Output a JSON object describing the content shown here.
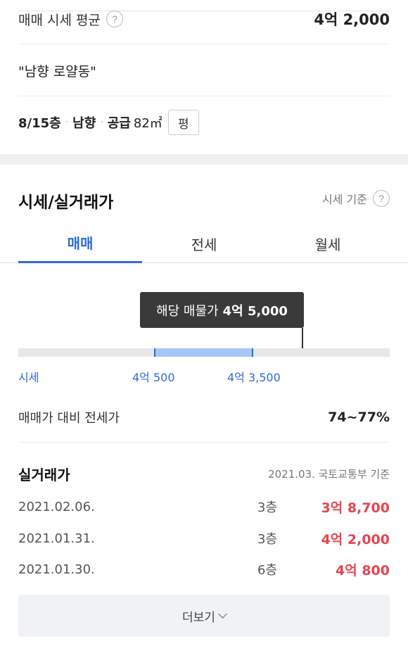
{
  "summary": {
    "avg_label": "매매 시세 평균",
    "help_icon": "question-circle-icon",
    "help_glyph": "?",
    "avg_value": "4억 2,000",
    "quote": "\"남향 로얄동\"",
    "floor": "8/15층",
    "direction": "남향",
    "supply_label": "공급",
    "supply_area": "82㎡",
    "sep": "·",
    "pyeong_button": "평"
  },
  "section": {
    "title": "시세/실거래가",
    "basis": "시세 기준",
    "basis_glyph": "?"
  },
  "tabs": [
    {
      "label": "매매",
      "active": true
    },
    {
      "label": "전세",
      "active": false
    },
    {
      "label": "월세",
      "active": false
    }
  ],
  "price_range": {
    "tooltip_label": "해당 매물가",
    "tooltip_value": "4억 5,000",
    "label": "시세",
    "low": "4억 500",
    "high": "4억 3,500"
  },
  "ratio": {
    "label": "매매가 대비 전세가",
    "value": "74~77%"
  },
  "deals": {
    "title": "실거래가",
    "basis": "2021.03. 국토교통부 기준",
    "rows": [
      {
        "date": "2021.02.06.",
        "floor": "3층",
        "price": "3억 8,700"
      },
      {
        "date": "2021.01.31.",
        "floor": "3층",
        "price": "4억 2,000"
      },
      {
        "date": "2021.01.30.",
        "floor": "6층",
        "price": "4억 800"
      }
    ]
  },
  "more_button": "더보기",
  "colors": {
    "accent": "#2d6ad4",
    "price_red": "#e5454f",
    "range_fill": "#a8c6f7"
  }
}
